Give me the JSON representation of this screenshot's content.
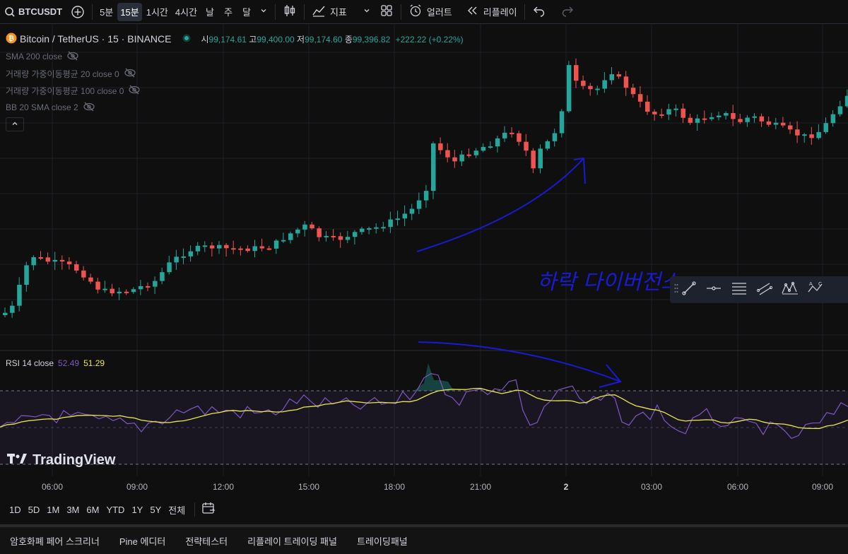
{
  "toolbar": {
    "symbol": "BTCUSDT",
    "timeframes": [
      "5분",
      "15분",
      "1시간",
      "4시간",
      "날",
      "주",
      "달"
    ],
    "active_timeframe": "15분",
    "indicators_label": "지표",
    "alert_label": "얼러트",
    "replay_label": "리플레이"
  },
  "legend": {
    "title": "Bitcoin / TetherUS · 15 · BINANCE",
    "open_k": "시",
    "open_v": "99,174.61",
    "high_k": "고",
    "high_v": "99,400.00",
    "low_k": "저",
    "low_v": "99,174.60",
    "close_k": "종",
    "close_v": "99,396.82",
    "change": "+222.22 (+0.22%)",
    "indicators": [
      "SMA 200 close",
      "거래량 가중이동평균 20 close 0",
      "거래량 가중이동평균 100 close 0",
      "BB 20 SMA close 2"
    ]
  },
  "rsi": {
    "label": "RSI 14 close",
    "value": "52.49",
    "ma_value": "51.29"
  },
  "annotation": "하락 다이버전스",
  "brand": "TradingView",
  "time_axis": [
    "06:00",
    "09:00",
    "12:00",
    "15:00",
    "18:00",
    "21:00",
    "2",
    "03:00",
    "06:00",
    "09:00"
  ],
  "ranges": [
    "1D",
    "5D",
    "1M",
    "3M",
    "6M",
    "YTD",
    "1Y",
    "5Y",
    "전체"
  ],
  "bottom_tabs": [
    "암호화폐 페어 스크리너",
    "Pine 에디터",
    "전략테스터",
    "리플레이 트레이딩 패널",
    "트레이딩패널"
  ],
  "colors": {
    "up": "#26a69a",
    "down": "#ef5350",
    "rsi_line": "#7e57c2",
    "rsi_ma": "#e8e84a",
    "annotation_ink": "#1a1ad4",
    "background": "#0f0f0f"
  }
}
